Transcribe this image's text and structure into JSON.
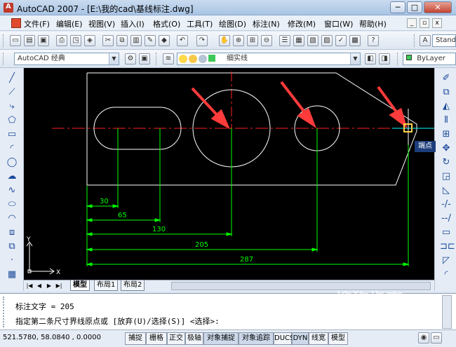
{
  "window": {
    "title": "AutoCAD 2007 - [E:\\我的cad\\基线标注.dwg]",
    "controls": {
      "minimize": "─",
      "maximize": "□",
      "close": "✕"
    }
  },
  "menu": {
    "items": [
      "文件(F)",
      "编辑(E)",
      "视图(V)",
      "插入(I)",
      "格式(O)",
      "工具(T)",
      "绘图(D)",
      "标注(N)",
      "修改(M)",
      "窗口(W)",
      "帮助(H)"
    ]
  },
  "toolbar": {
    "workspace": "AutoCAD 经典",
    "layer": "细实线",
    "style_partial": "Stand",
    "color": "ByLayer"
  },
  "tabs": [
    "模型",
    "布局1",
    "布局2"
  ],
  "tooltip": "端点",
  "drawing": {
    "dim_labels": [
      "30",
      "65",
      "130",
      "205",
      "287"
    ],
    "ucs_y": "Y",
    "ucs_x": "X"
  },
  "command": {
    "line1": "标注文字 = 205",
    "line2": "指定第二条尺寸界线原点或 [放弃(U)/选择(S)] <选择>:"
  },
  "status": {
    "coords": "521.5780, 58.0840 , 0.0000",
    "buttons": [
      "捕捉",
      "栅格",
      "正交",
      "极轴",
      "对象捕捉",
      "对象追踪",
      "DUCS",
      "DYN",
      "线宽",
      "模型"
    ]
  },
  "watermark": {
    "brand": "搜狗指南",
    "url": "zhinan.sogou.com"
  },
  "colors": {
    "canvas": "#000000",
    "outline": "#ffffff",
    "centerline": "#ff0000",
    "dimension": "#00ff00",
    "arrow": "#ff3b3b"
  }
}
